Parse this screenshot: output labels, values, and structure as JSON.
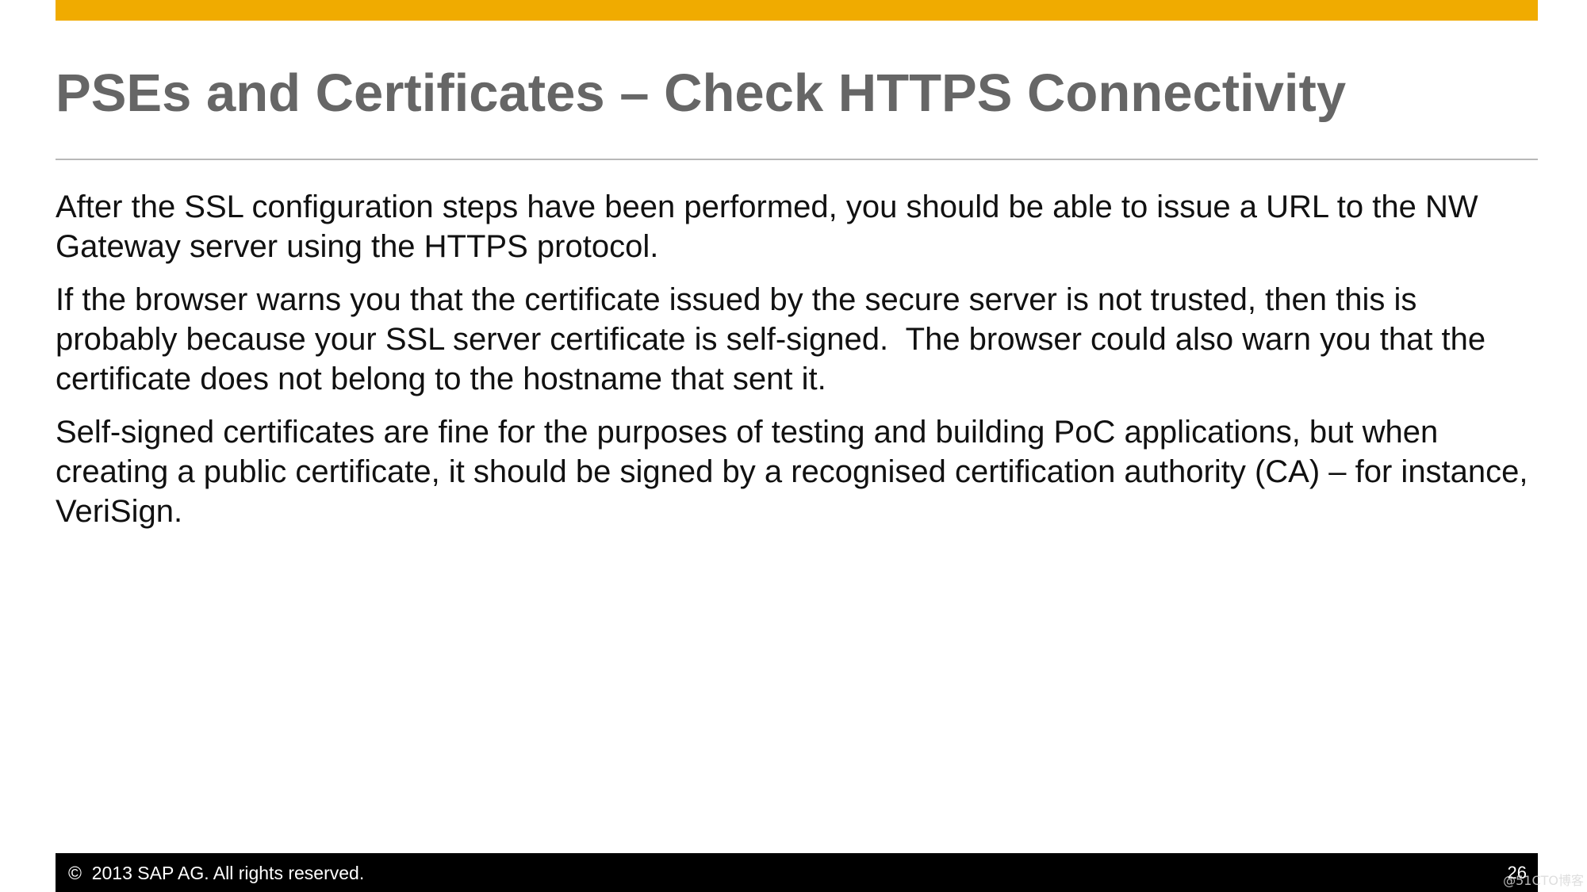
{
  "slide": {
    "title": "PSEs and Certificates – Check HTTPS Connectivity",
    "paragraphs": [
      "After the SSL configuration steps have been performed, you should be able to issue a URL to the NW Gateway server using the HTTPS protocol.",
      "If the browser warns you that the certificate issued by the secure server is not trusted, then this is probably because your SSL server certificate is self-signed.  The browser could also warn you that the certificate does not belong to the hostname that sent it.",
      "Self-signed certificates are fine for the purposes of testing and building PoC applications, but when creating a public certificate, it should be signed by a recognised certification authority (CA) – for instance, VeriSign."
    ]
  },
  "footer": {
    "copyright": "©  2013 SAP AG. All rights reserved.",
    "page_number": "26"
  },
  "watermark": "@51CTO博客",
  "colors": {
    "accent_bar": "#f0ab00",
    "title": "#666666",
    "footer_bg": "#000000"
  }
}
